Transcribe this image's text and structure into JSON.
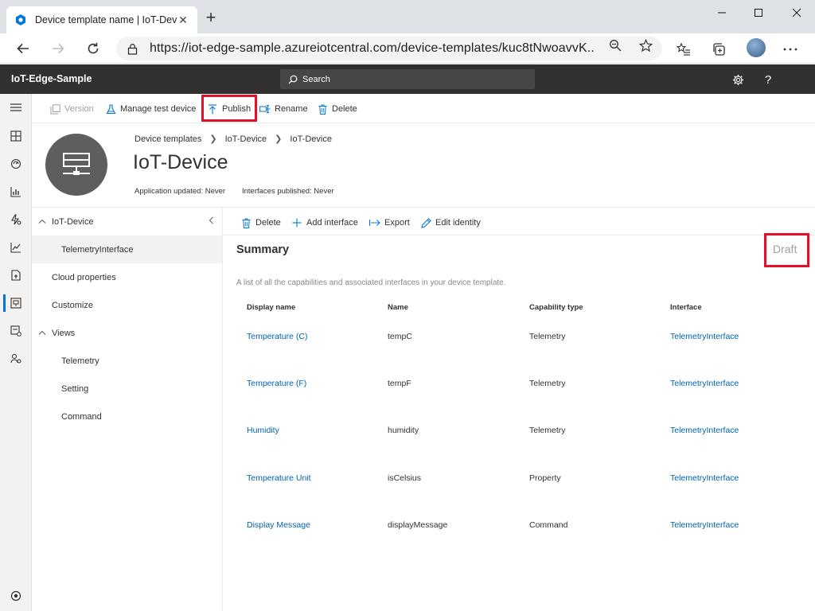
{
  "browser": {
    "tab_title": "Device template name | IoT-Dev",
    "url": "https://iot-edge-sample.azureiotcentral.com/device-templates/kuc8tNwoavvK..."
  },
  "app": {
    "name": "IoT-Edge-Sample",
    "search_placeholder": "Search"
  },
  "commandbar": {
    "version": "Version",
    "manage_test_device": "Manage test device",
    "publish": "Publish",
    "rename": "Rename",
    "delete": "Delete"
  },
  "header": {
    "breadcrumb": [
      "Device templates",
      "IoT-Device",
      "IoT-Device"
    ],
    "title": "IoT-Device",
    "application_updated": "Application updated: Never",
    "interfaces_published": "Interfaces published: Never"
  },
  "tree": {
    "root": "IoT-Device",
    "interface": "TelemetryInterface",
    "cloud_properties": "Cloud properties",
    "customize": "Customize",
    "views": "Views",
    "views_items": [
      "Telemetry",
      "Setting",
      "Command"
    ]
  },
  "content_cmd": {
    "delete": "Delete",
    "add_interface": "Add interface",
    "export": "Export",
    "edit_identity": "Edit identity"
  },
  "summary": {
    "title": "Summary",
    "status": "Draft",
    "description": "A list of all the capabilities and associated interfaces in your device template.",
    "columns": [
      "Display name",
      "Name",
      "Capability type",
      "Interface"
    ],
    "rows": [
      {
        "display_name": "Temperature (C)",
        "name": "tempC",
        "capability": "Telemetry",
        "interface": "TelemetryInterface"
      },
      {
        "display_name": "Temperature (F)",
        "name": "tempF",
        "capability": "Telemetry",
        "interface": "TelemetryInterface"
      },
      {
        "display_name": "Humidity",
        "name": "humidity",
        "capability": "Telemetry",
        "interface": "TelemetryInterface"
      },
      {
        "display_name": "Temperature Unit",
        "name": "isCelsius",
        "capability": "Property",
        "interface": "TelemetryInterface"
      },
      {
        "display_name": "Display Message",
        "name": "displayMessage",
        "capability": "Command",
        "interface": "TelemetryInterface"
      }
    ]
  },
  "colors": {
    "accent": "#0078d4",
    "link": "#0063b1",
    "highlight": "#e60f29",
    "appbar": "#323130"
  }
}
